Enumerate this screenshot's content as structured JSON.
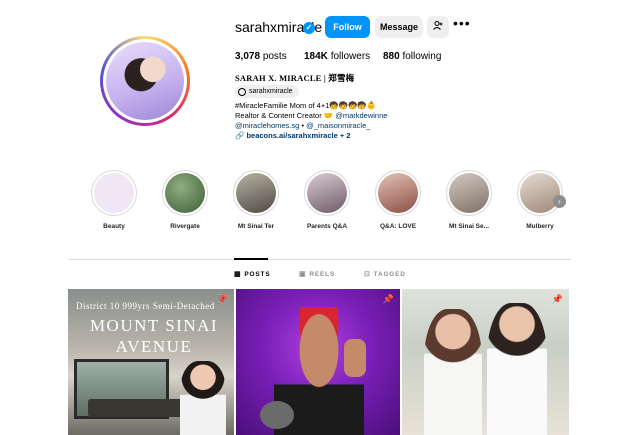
{
  "profile": {
    "username": "sarahxmiracle",
    "verified_icon": "verified-badge-icon",
    "follow_label": "Follow",
    "message_label": "Message",
    "add_user_icon": "add-user-icon",
    "more_icon": "more-options-icon",
    "posts_count": "3,078",
    "posts_label": "posts",
    "followers_count": "184K",
    "followers_label": "followers",
    "following_count": "880",
    "following_label": "following",
    "full_name": "SARAH X. MIRACLE | 郑雪梅",
    "threads_handle": "sarahxmiracle",
    "bio_line1": "#MiracleFamilie Mom of 4+1🧒🧒🧒🧒👶",
    "bio_line2_text": "Realtor & Content Creator 🤝 ",
    "bio_line2_link": "@markdewinne",
    "bio_line3_link1": "@miraclehomes.sg",
    "bio_line3_sep": " • ",
    "bio_line3_link2": "@_maisonmiracle_",
    "bio_link": "beacons.ai/sarahxmiracle + 2"
  },
  "highlights": [
    {
      "label": "Beauty",
      "color": "#efe7f6"
    },
    {
      "label": "Rivergate",
      "color": "#5d7a55"
    },
    {
      "label": "Mt Sinai Ter",
      "color": "#6e6a60"
    },
    {
      "label": "Parents Q&A",
      "color": "#8d7f86"
    },
    {
      "label": "Q&A: LOVE",
      "color": "#a36b5f"
    },
    {
      "label": "Mt Sinai Se...",
      "color": "#9c8f86"
    },
    {
      "label": "Mulberry",
      "color": "#b8a79b"
    }
  ],
  "tabs": [
    {
      "label": "POSTS",
      "icon": "grid-icon",
      "active": true
    },
    {
      "label": "REELS",
      "icon": "reels-icon",
      "active": false
    },
    {
      "label": "TAGGED",
      "icon": "tagged-icon",
      "active": false
    }
  ],
  "posts": [
    {
      "subtitle": "District 10 999yrs Semi-Detached",
      "title": "MOUNT SINAI AVENUE",
      "pinned_icon": "pin-icon"
    },
    {
      "pinned_icon": "pin-icon"
    },
    {
      "pinned_icon": "pin-icon"
    }
  ],
  "colors": {
    "accent": "#0095f6",
    "link": "#00376b",
    "muted": "#8e8e8e"
  }
}
